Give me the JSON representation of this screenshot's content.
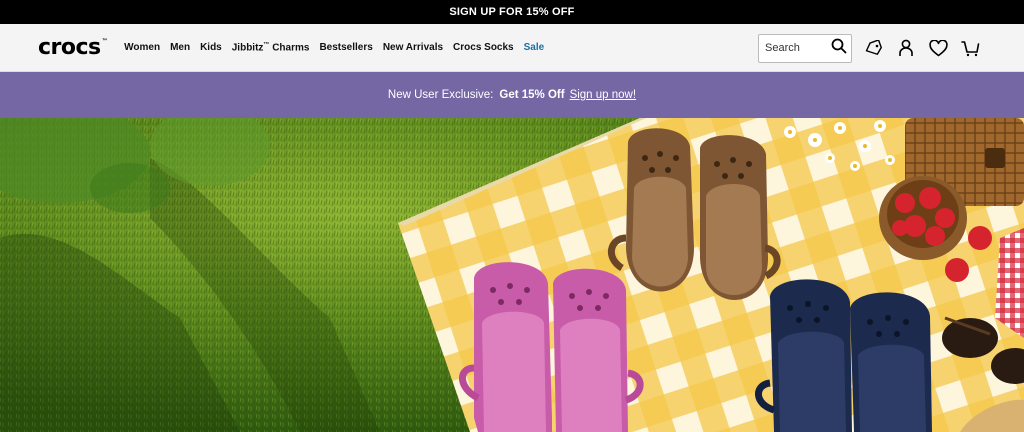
{
  "promo_bar": {
    "text": "SIGN UP FOR 15% OFF"
  },
  "header": {
    "logo_text": "crocs",
    "nav": [
      {
        "label": "Women"
      },
      {
        "label": "Men"
      },
      {
        "label": "Kids"
      },
      {
        "label": "Jibbitz",
        "superscript": "™",
        "suffix": " Charms"
      },
      {
        "label": "Bestsellers"
      },
      {
        "label": "New Arrivals"
      },
      {
        "label": "Crocs Socks"
      },
      {
        "label": "Sale"
      }
    ],
    "search": {
      "placeholder": "Search"
    },
    "icons": [
      "search-icon",
      "tag-icon",
      "account-icon",
      "heart-icon",
      "cart-icon"
    ]
  },
  "exclusive_banner": {
    "lead": "New User Exclusive:",
    "offer": "Get 15% Off",
    "link": "Sign up now!"
  },
  "colors": {
    "promo_bg": "#000000",
    "banner_bg": "#7467a4",
    "sale_link": "#1b6fa8"
  }
}
